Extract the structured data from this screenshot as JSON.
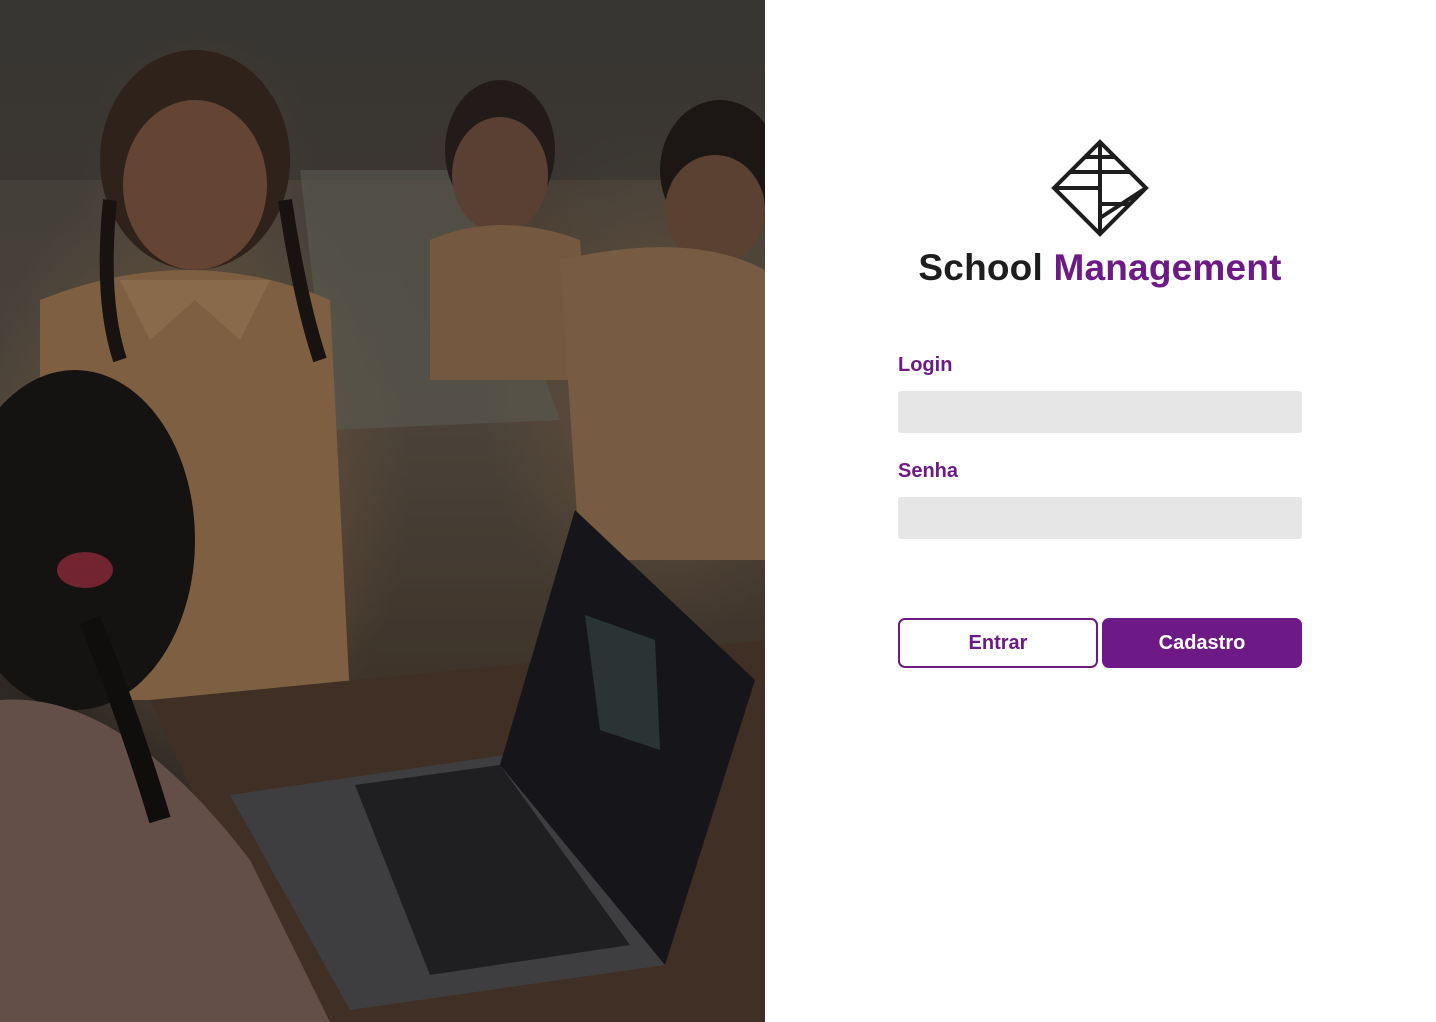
{
  "brand": {
    "title_part1": "School",
    "title_part2": "Management",
    "logo_icon": "tangram-diamond-icon"
  },
  "form": {
    "login_label": "Login",
    "login_value": "",
    "password_label": "Senha",
    "password_value": ""
  },
  "buttons": {
    "enter_label": "Entrar",
    "register_label": "Cadastro"
  },
  "colors": {
    "accent": "#6e1a86",
    "input_bg": "#e6e6e6",
    "dark_text": "#1d1d1d"
  }
}
